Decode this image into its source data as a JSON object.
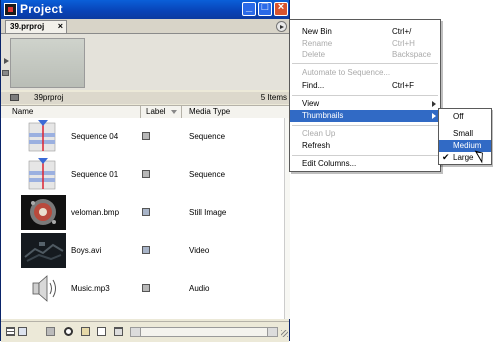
{
  "window": {
    "title": "Project"
  },
  "tab": {
    "label": "39.prproj",
    "close": "×"
  },
  "info": {
    "project_name": "39prproj",
    "item_count": "5 Items"
  },
  "columns": {
    "name": "Name",
    "label": "Label",
    "media_type": "Media Type"
  },
  "items": [
    {
      "name": "Sequence 04",
      "media_type": "Sequence",
      "label_color": "#b8b8b8",
      "icon": "sequence-icon"
    },
    {
      "name": "Sequence 01",
      "media_type": "Sequence",
      "label_color": "#b8b8b8",
      "icon": "sequence-icon"
    },
    {
      "name": "veloman.bmp",
      "media_type": "Still Image",
      "label_color": "#a8b4c8",
      "icon": "still-image-icon"
    },
    {
      "name": "Boys.avi",
      "media_type": "Video",
      "label_color": "#a8b4c8",
      "icon": "video-icon"
    },
    {
      "name": "Music.mp3",
      "media_type": "Audio",
      "label_color": "#b8b8b8",
      "icon": "audio-speaker-icon"
    }
  ],
  "menu": {
    "new_bin": {
      "label": "New Bin",
      "shortcut": "Ctrl+/"
    },
    "rename": {
      "label": "Rename",
      "shortcut": "Ctrl+H"
    },
    "delete": {
      "label": "Delete",
      "shortcut": "Backspace"
    },
    "automate": {
      "label": "Automate to Sequence..."
    },
    "find": {
      "label": "Find...",
      "shortcut": "Ctrl+F"
    },
    "view": {
      "label": "View"
    },
    "thumbnails": {
      "label": "Thumbnails"
    },
    "clean_up": {
      "label": "Clean Up"
    },
    "refresh": {
      "label": "Refresh"
    },
    "edit_columns": {
      "label": "Edit Columns..."
    }
  },
  "submenu": {
    "off": "Off",
    "small": "Small",
    "medium": "Medium",
    "large": "Large",
    "check": "✔"
  },
  "colors": {
    "title_bar": "#0842b6",
    "selection": "#316ac5",
    "close_button": "#d8532e"
  }
}
